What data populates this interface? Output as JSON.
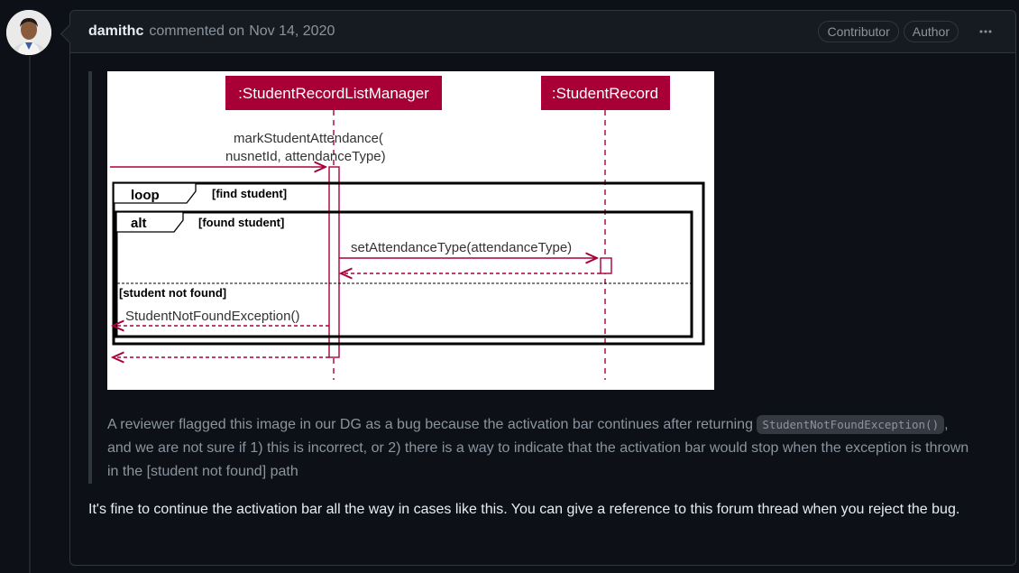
{
  "comment": {
    "author": "damithc",
    "action": "commented on",
    "date": "Nov 14, 2020",
    "badges": [
      "Contributor",
      "Author"
    ],
    "more_icon": "kebab-horizontal-icon"
  },
  "diagram": {
    "lifeline1": ":StudentRecordListManager",
    "lifeline2": ":StudentRecord",
    "call_line1": "markStudentAttendance(",
    "call_line2": "nusnetId, attendanceType)",
    "loop_label": "loop",
    "loop_guard": "[find student]",
    "alt_label": "alt",
    "alt_guard": "[found student]",
    "inner_call": "setAttendanceType(attendanceType)",
    "else_guard": "[student not found]",
    "exception": "StudentNotFoundException()",
    "colors": {
      "lifeline_fill": "#a80036",
      "arrow": "#a80036"
    }
  },
  "quote": {
    "part1": "A reviewer flagged this image in our DG as a bug because the activation bar continues after returning",
    "code": "StudentNotFoundException()",
    "part2": ", and we are not sure if 1) this is incorrect, or 2) there is a way to indicate that the activation bar would stop when the exception is thrown in the [student not found] path"
  },
  "reply": "It's fine to continue the activation bar all the way in cases like this. You can give a reference to this forum thread when you reject the bug."
}
